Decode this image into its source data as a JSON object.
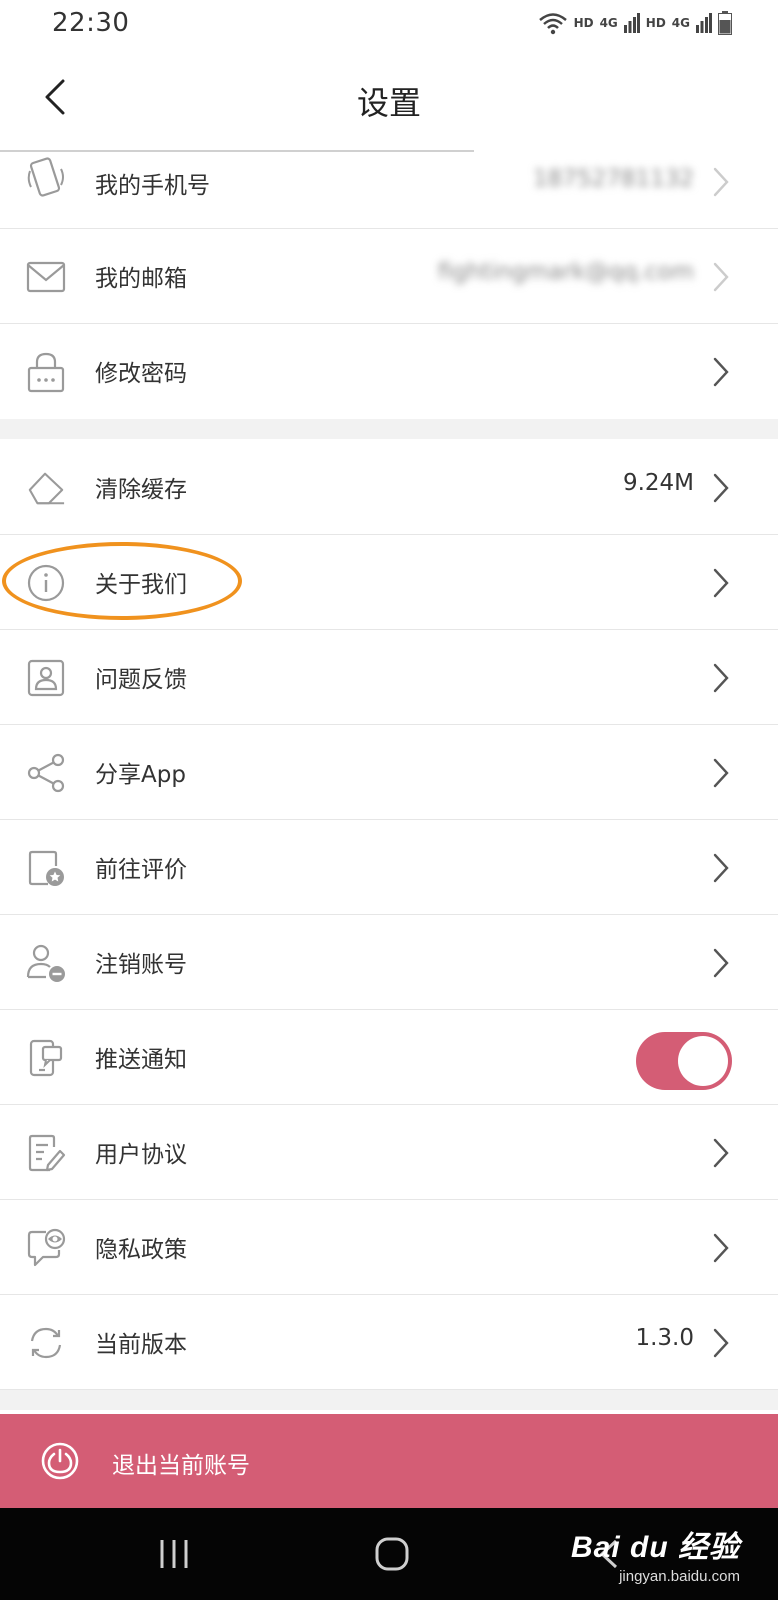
{
  "status_bar": {
    "time": "22:30",
    "network_hd_1": "HD",
    "network_4g_1": "4G",
    "network_hd_2": "HD",
    "network_4g_2": "4G",
    "icons": [
      "wifi-icon",
      "signal-icon",
      "signal-icon",
      "battery-icon"
    ]
  },
  "header": {
    "title": "设置",
    "back_icon": "chevron-left-icon"
  },
  "account_section": [
    {
      "label": "我的手机号",
      "value": "18752781132",
      "icon": "phone-icon",
      "value_blurred": true
    },
    {
      "label": "我的邮箱",
      "value": "fightingmark@qq.com",
      "icon": "mail-icon",
      "value_blurred": true
    },
    {
      "label": "修改密码",
      "value": "",
      "icon": "lock-icon"
    }
  ],
  "settings_section": [
    {
      "label": "清除缓存",
      "value": "9.24M",
      "icon": "eraser-icon"
    },
    {
      "label": "关于我们",
      "value": "",
      "icon": "info-icon"
    },
    {
      "label": "问题反馈",
      "value": "",
      "icon": "feedback-icon"
    },
    {
      "label": "分享App",
      "value": "",
      "icon": "share-icon"
    },
    {
      "label": "前往评价",
      "value": "",
      "icon": "rate-icon"
    },
    {
      "label": "注销账号",
      "value": "",
      "icon": "remove-user-icon"
    },
    {
      "label": "推送通知",
      "value": "",
      "icon": "notification-icon",
      "toggle": true,
      "toggle_on": true
    },
    {
      "label": "用户协议",
      "value": "",
      "icon": "agreement-icon"
    },
    {
      "label": "隐私政策",
      "value": "",
      "icon": "privacy-icon"
    },
    {
      "label": "当前版本",
      "value": "1.3.0",
      "icon": "refresh-icon"
    }
  ],
  "logout": {
    "label": "退出当前账号",
    "icon": "power-icon"
  },
  "system_nav": [
    "recent-apps-icon",
    "home-icon",
    "back-icon"
  ],
  "watermark": {
    "brand": "Bai du 经验",
    "url": "jingyan.baidu.com"
  },
  "colors": {
    "accent": "#d45d75",
    "highlight": "#f0921e",
    "divider": "#e6e6e6",
    "section_gap": "#f2f2f2"
  }
}
